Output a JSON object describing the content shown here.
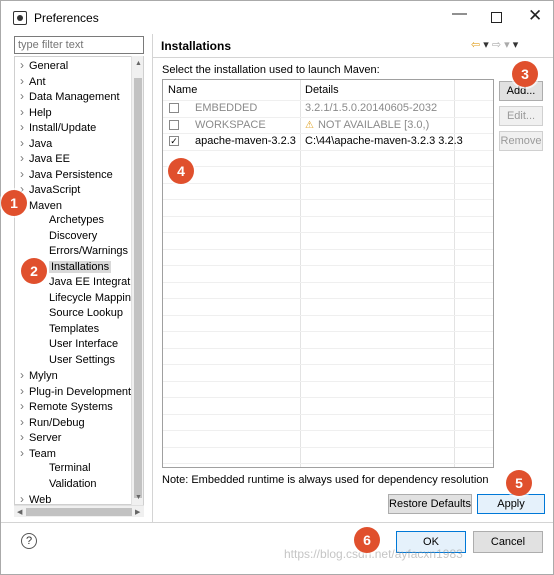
{
  "window": {
    "title": "Preferences",
    "minimize": "—",
    "close": "✕"
  },
  "filter": {
    "placeholder": "type filter text"
  },
  "tree": {
    "items": [
      {
        "label": "General",
        "expandable": true
      },
      {
        "label": "Ant",
        "expandable": true
      },
      {
        "label": "Data Management",
        "expandable": true
      },
      {
        "label": "Help",
        "expandable": true
      },
      {
        "label": "Install/Update",
        "expandable": true
      },
      {
        "label": "Java",
        "expandable": true
      },
      {
        "label": "Java EE",
        "expandable": true
      },
      {
        "label": "Java Persistence",
        "expandable": true
      },
      {
        "label": "JavaScript",
        "expandable": true
      },
      {
        "label": "Maven",
        "expandable": true
      },
      {
        "label": "Archetypes"
      },
      {
        "label": "Discovery"
      },
      {
        "label": "Errors/Warnings"
      },
      {
        "label": "Installations",
        "selected": true
      },
      {
        "label": "Java EE Integration"
      },
      {
        "label": "Lifecycle Mapping"
      },
      {
        "label": "Source Lookup"
      },
      {
        "label": "Templates"
      },
      {
        "label": "User Interface"
      },
      {
        "label": "User Settings"
      },
      {
        "label": "Mylyn",
        "expandable": true
      },
      {
        "label": "Plug-in Development",
        "expandable": true
      },
      {
        "label": "Remote Systems",
        "expandable": true
      },
      {
        "label": "Run/Debug",
        "expandable": true
      },
      {
        "label": "Server",
        "expandable": true
      },
      {
        "label": "Team",
        "expandable": true
      },
      {
        "label": "Terminal"
      },
      {
        "label": "Validation"
      },
      {
        "label": "Web",
        "expandable": true
      }
    ]
  },
  "page": {
    "title": "Installations",
    "instruction": "Select the installation used to launch Maven:",
    "columns": {
      "name": "Name",
      "details": "Details"
    },
    "rows": [
      {
        "checked": false,
        "name": "EMBEDDED",
        "details": "3.2.1/1.5.0.20140605-2032",
        "disabled": true,
        "warning": false
      },
      {
        "checked": false,
        "name": "WORKSPACE",
        "details": "NOT AVAILABLE [3.0,)",
        "disabled": true,
        "warning": true
      },
      {
        "checked": true,
        "name": "apache-maven-3.2.3",
        "details": "C:\\44\\apache-maven-3.2.3 3.2.3",
        "disabled": false,
        "warning": false
      }
    ],
    "note": "Note: Embedded runtime is always used for dependency resolution"
  },
  "buttons": {
    "add": "Add...",
    "edit": "Edit...",
    "remove": "Remove",
    "restore_defaults": "Restore Defaults",
    "apply": "Apply",
    "ok": "OK",
    "cancel": "Cancel",
    "help": "?"
  },
  "callouts": [
    "1",
    "2",
    "3",
    "4",
    "5",
    "6"
  ],
  "watermark": "https://blog.csdn.net/ayfacxn1983"
}
